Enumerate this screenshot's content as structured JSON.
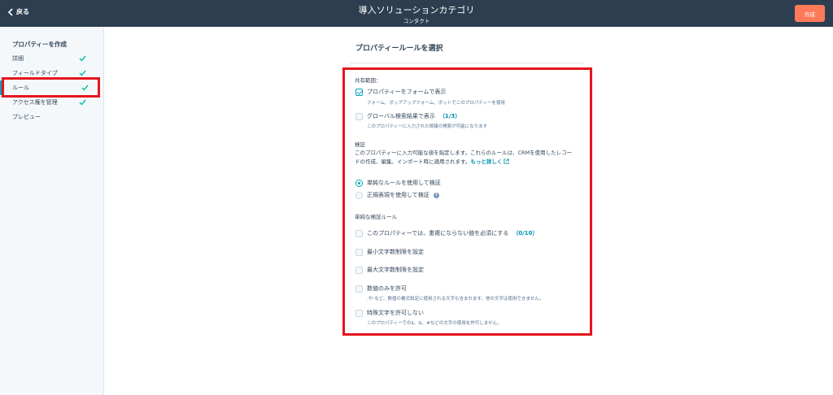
{
  "header": {
    "back_label": "戻る",
    "title": "導入ソリューションカテゴリ",
    "subtitle": "コンタクト",
    "create_label": "作成"
  },
  "sidebar": {
    "heading": "プロパティーを作成",
    "items": [
      {
        "label": "詳細",
        "done": true
      },
      {
        "label": "フィールドタイプ",
        "done": true
      },
      {
        "label": "ルール",
        "done": true,
        "active": true
      },
      {
        "label": "アクセス権を管理",
        "done": true
      },
      {
        "label": "プレビュー",
        "done": false
      }
    ]
  },
  "main": {
    "title": "プロパティールールを選択",
    "shared_scope": {
      "label": "共有範囲：",
      "show_on_forms": {
        "label": "プロパティーをフォームで表示",
        "hint": "フォーム、ポップアップフォーム、ボットでこのプロパティーを使用",
        "checked": true
      },
      "global_search": {
        "label": "グローバル検索結果で表示",
        "count": "（1/3）",
        "hint": "このプロパティーに入力された情報の検索が可能になります",
        "checked": false
      }
    },
    "validation": {
      "label": "検証",
      "desc_line1": "このプロパティーに入力可能な値を指定します。これらのルールは、CRMを使用したレコー",
      "desc_line2": "ドの作成、編集、インポート時に適用されます。",
      "learn_more": "もっと詳しく",
      "radio_simple": "単純なルールを使用して検証",
      "radio_regex": "正規表現を使用して検証",
      "selected": "simple"
    },
    "simple_rules": {
      "label": "単純な検証ルール",
      "unique": {
        "label": "このプロパティーでは、重複にならない値を必須にする",
        "count": "（0/10）"
      },
      "min_length": {
        "label": "最小文字数制限を設定"
      },
      "max_length": {
        "label": "最大文字数制限を設定"
      },
      "numeric_only": {
        "label": "数値のみを許可",
        "hint": ".や-など、数値の書式設定に使用される文字も含まれます。他の文字は使用できません。"
      },
      "no_special": {
        "label": "特殊文字を許可しない",
        "hint": "このプロパティーでの$、&、#などの文字の使用を許可しません。"
      }
    }
  },
  "colors": {
    "header_bg": "#2d3e50",
    "accent": "#00a4bd",
    "create_button": "#ff7a59",
    "highlight_box": "#e5151d"
  }
}
